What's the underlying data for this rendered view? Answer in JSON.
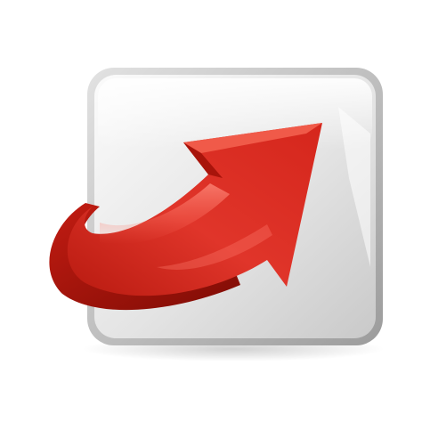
{
  "icon": {
    "name": "arrow-export-icon",
    "colors": {
      "tile_light": "#f4f4f4",
      "tile_mid": "#d6d6d6",
      "tile_dark": "#a9a9a9",
      "arrow_light": "#ee4a3a",
      "arrow_main": "#d8261b",
      "arrow_dark": "#9e1209"
    }
  }
}
